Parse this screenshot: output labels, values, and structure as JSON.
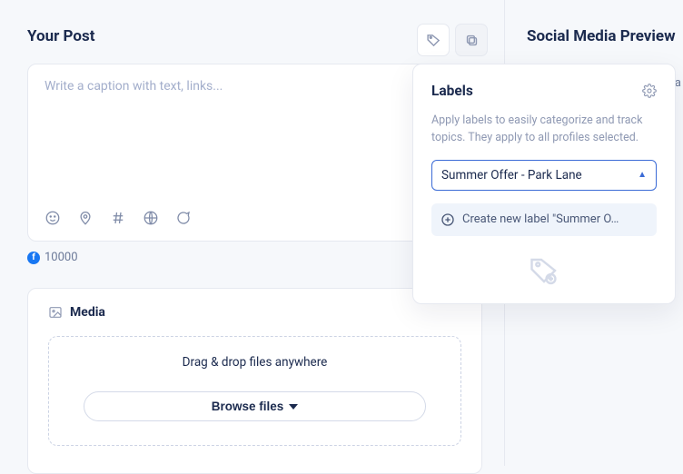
{
  "post": {
    "heading": "Your Post",
    "caption_placeholder": "Write a caption with text, links...",
    "char_count": "10000",
    "right_clip_text": "This is a"
  },
  "media": {
    "heading": "Media",
    "drop_text": "Drag & drop files anywhere",
    "browse_label": "Browse files"
  },
  "preview": {
    "heading": "Social Media Preview",
    "stray_char": "a"
  },
  "labels": {
    "title": "Labels",
    "description": "Apply labels to easily categorize and track topics. They apply to all profiles selected.",
    "selected": "Summer Offer - Park Lane",
    "create_text": "Create new label \"Summer O…"
  }
}
